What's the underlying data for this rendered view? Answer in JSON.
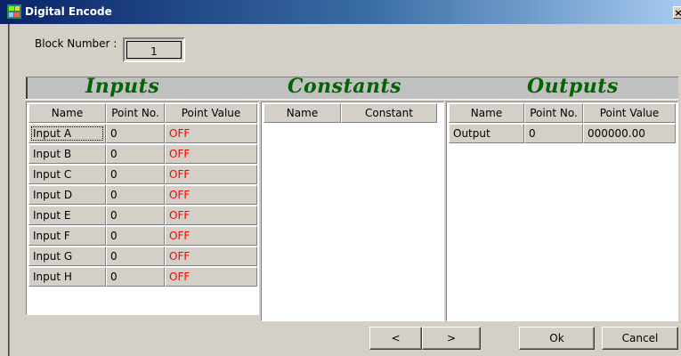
{
  "window": {
    "title": "Digital Encode",
    "close_glyph": "×"
  },
  "block": {
    "label": "Block Number :",
    "value": "1"
  },
  "sections": {
    "inputs": "Inputs",
    "constants": "Constants",
    "outputs": "Outputs"
  },
  "inputs": {
    "headers": [
      "Name",
      "Point No.",
      "Point Value"
    ],
    "rows": [
      {
        "name": "Input A",
        "point_no": "0",
        "value": "OFF"
      },
      {
        "name": "Input B",
        "point_no": "0",
        "value": "OFF"
      },
      {
        "name": "Input C",
        "point_no": "0",
        "value": "OFF"
      },
      {
        "name": "Input D",
        "point_no": "0",
        "value": "OFF"
      },
      {
        "name": "Input E",
        "point_no": "0",
        "value": "OFF"
      },
      {
        "name": "Input F",
        "point_no": "0",
        "value": "OFF"
      },
      {
        "name": "Input G",
        "point_no": "0",
        "value": "OFF"
      },
      {
        "name": "Input H",
        "point_no": "0",
        "value": "OFF"
      }
    ]
  },
  "constants": {
    "headers": [
      "Name",
      "Constant"
    ],
    "rows": []
  },
  "outputs": {
    "headers": [
      "Name",
      "Point No.",
      "Point Value"
    ],
    "rows": [
      {
        "name": "Output",
        "point_no": "0",
        "value": "000000.00"
      }
    ]
  },
  "buttons": {
    "prev": "<",
    "next": ">",
    "ok": "Ok",
    "cancel": "Cancel"
  },
  "colors": {
    "off_value": "#ff0000",
    "section_title": "#006400",
    "title_bar": "#0a246a"
  },
  "icons": {
    "app": "app-block-icon",
    "close": "close-icon"
  }
}
